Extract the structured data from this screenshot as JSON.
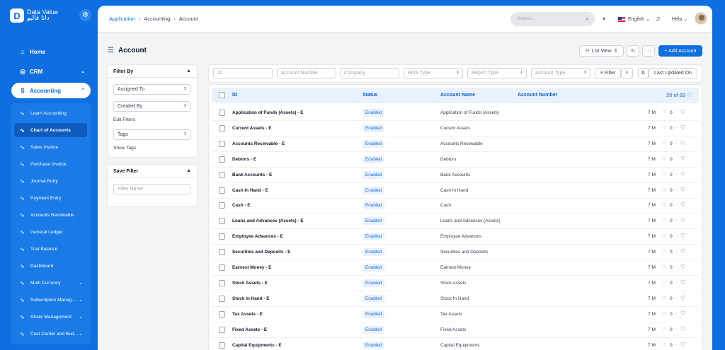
{
  "brand": {
    "name_en": "Data Value",
    "name_ar": "داتا ڤاليو",
    "logo_icon": "dv-logo-icon"
  },
  "sidebar": {
    "top_items": [
      {
        "label": "Home",
        "icon": "home-icon"
      },
      {
        "label": "CRM",
        "icon": "crm-icon"
      },
      {
        "label": "Accounting",
        "icon": "accounting-icon"
      }
    ],
    "accounting_items": [
      {
        "label": "Learn Accounting"
      },
      {
        "label": "Chart of Accounts"
      },
      {
        "label": "Sales Invoice"
      },
      {
        "label": "Purchase Invoice"
      },
      {
        "label": "Journal Entry"
      },
      {
        "label": "Payment Entry"
      },
      {
        "label": "Accounts Receivable"
      },
      {
        "label": "General Ledger"
      },
      {
        "label": "Trial Balance"
      },
      {
        "label": "Dashboard"
      },
      {
        "label": "Multi Currency"
      },
      {
        "label": "Subscription Manag..."
      },
      {
        "label": "Share Management"
      },
      {
        "label": "Cost Center and Bud..."
      }
    ]
  },
  "breadcrumb": {
    "items": [
      "Application",
      "Accounting",
      "Account"
    ]
  },
  "topbar": {
    "search_placeholder": "Search...",
    "language": "English",
    "help": "Help"
  },
  "page": {
    "title": "Account",
    "list_view_label": "List View",
    "more_label": "···",
    "add_label": "+ Add Account"
  },
  "filter_panel": {
    "title": "Filter By",
    "assigned_to": "Assigned To",
    "created_by": "Created By",
    "edit_filters": "Edit Filters",
    "tags": "Tags",
    "show_tags": "Show Tags"
  },
  "save_filter": {
    "title": "Save Filter",
    "placeholder": "Filter Name"
  },
  "filter_bar": {
    "id": "ID",
    "account_number": "Account Number",
    "company": "Company",
    "root_type": "Root Type",
    "report_type": "Report Type",
    "account_type": "Account Type",
    "filter_label": "Filter",
    "clear_label": "×",
    "sort_label": "Last Updated On"
  },
  "table": {
    "headers": {
      "id": "ID",
      "status": "Status",
      "account_name": "Account Name",
      "account_number": "Account Number"
    },
    "count": "20 of 83",
    "rows": [
      {
        "id": "Application of Funds (Assets) - E",
        "status": "Enabled",
        "name": "Application of Funds (Assets)",
        "time": "7 M",
        "comments": "0"
      },
      {
        "id": "Current Assets - E",
        "status": "Enabled",
        "name": "Current Assets",
        "time": "7 M",
        "comments": "0"
      },
      {
        "id": "Accounts Receivable - E",
        "status": "Enabled",
        "name": "Accounts Receivable",
        "time": "7 M",
        "comments": "0"
      },
      {
        "id": "Debtors - E",
        "status": "Enabled",
        "name": "Debtors",
        "time": "7 M",
        "comments": "0"
      },
      {
        "id": "Bank Accounts - E",
        "status": "Enabled",
        "name": "Bank Accounts",
        "time": "7 M",
        "comments": "0"
      },
      {
        "id": "Cash In Hand - E",
        "status": "Enabled",
        "name": "Cash In Hand",
        "time": "7 M",
        "comments": "0"
      },
      {
        "id": "Cash - E",
        "status": "Enabled",
        "name": "Cash",
        "time": "7 M",
        "comments": "0"
      },
      {
        "id": "Loans and Advances (Assets) - E",
        "status": "Enabled",
        "name": "Loans and Advances (Assets)",
        "time": "7 M",
        "comments": "0"
      },
      {
        "id": "Employee Advances - E",
        "status": "Enabled",
        "name": "Employee Advances",
        "time": "7 M",
        "comments": "0"
      },
      {
        "id": "Securities and Deposits - E",
        "status": "Enabled",
        "name": "Securities and Deposits",
        "time": "7 M",
        "comments": "0"
      },
      {
        "id": "Earnest Money - E",
        "status": "Enabled",
        "name": "Earnest Money",
        "time": "7 M",
        "comments": "0"
      },
      {
        "id": "Stock Assets - E",
        "status": "Enabled",
        "name": "Stock Assets",
        "time": "7 M",
        "comments": "0"
      },
      {
        "id": "Stock In Hand - E",
        "status": "Enabled",
        "name": "Stock In Hand",
        "time": "7 M",
        "comments": "0"
      },
      {
        "id": "Tax Assets - E",
        "status": "Enabled",
        "name": "Tax Assets",
        "time": "7 M",
        "comments": "0"
      },
      {
        "id": "Fixed Assets - E",
        "status": "Enabled",
        "name": "Fixed Assets",
        "time": "7 M",
        "comments": "0"
      },
      {
        "id": "Capital Equipments - E",
        "status": "Enabled",
        "name": "Capital Equipments",
        "time": "7 M",
        "comments": "0"
      }
    ]
  },
  "colors": {
    "brand": "#0f6fe0",
    "status_bg": "#e8f1fc",
    "status_text": "#1d6fd6"
  }
}
